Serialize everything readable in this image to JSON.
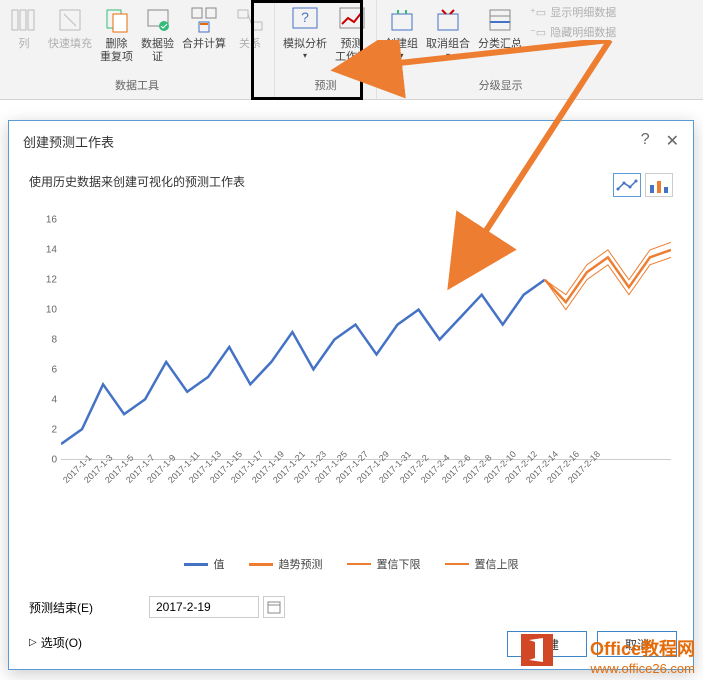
{
  "ribbon": {
    "groups": [
      {
        "label": "数据工具",
        "buttons": [
          {
            "name": "columns-btn",
            "label": "列",
            "disabled": true
          },
          {
            "name": "flash-fill-btn",
            "label": "快速填充",
            "disabled": true
          },
          {
            "name": "remove-dup-btn",
            "label": "删除\n重复项"
          },
          {
            "name": "data-validation-btn",
            "label": "数据验\n证"
          },
          {
            "name": "consolidate-btn",
            "label": "合并计算"
          },
          {
            "name": "relations-btn",
            "label": "关系",
            "disabled": true
          }
        ]
      },
      {
        "label": "预测",
        "buttons": [
          {
            "name": "what-if-btn",
            "label": "模拟分析"
          },
          {
            "name": "forecast-sheet-btn",
            "label": "预测\n工作表"
          }
        ]
      },
      {
        "label": "分级显示",
        "buttons": [
          {
            "name": "group-btn",
            "label": "创建组"
          },
          {
            "name": "ungroup-btn",
            "label": "取消组合"
          },
          {
            "name": "subtotal-btn",
            "label": "分类汇总"
          }
        ],
        "text_buttons": [
          {
            "name": "show-detail-btn",
            "label": "显示明细数据"
          },
          {
            "name": "hide-detail-btn",
            "label": "隐藏明细数据"
          }
        ]
      }
    ]
  },
  "dialog": {
    "title": "创建预测工作表",
    "subtitle": "使用历史数据来创建可视化的预测工作表",
    "help": "?",
    "close": "✕",
    "form": {
      "end_label": "预测结束(E)",
      "end_value": "2017-2-19"
    },
    "options_label": "选项(O)",
    "ok_label": "创建",
    "cancel_label": "取消"
  },
  "chart_data": {
    "type": "line",
    "ylim": [
      0,
      16
    ],
    "yticks": [
      0,
      2,
      4,
      6,
      8,
      10,
      12,
      14,
      16
    ],
    "categories": [
      "2017-1-1",
      "2017-1-3",
      "2017-1-5",
      "2017-1-7",
      "2017-1-9",
      "2017-1-11",
      "2017-1-13",
      "2017-1-15",
      "2017-1-17",
      "2017-1-19",
      "2017-1-21",
      "2017-1-23",
      "2017-1-25",
      "2017-1-27",
      "2017-1-29",
      "2017-1-31",
      "2017-2-2",
      "2017-2-4",
      "2017-2-6",
      "2017-2-8",
      "2017-2-10",
      "2017-2-12",
      "2017-2-14",
      "2017-2-16",
      "2017-2-18"
    ],
    "series": [
      {
        "name": "值",
        "color": "#4472c4",
        "values": [
          1,
          2,
          5,
          3,
          4,
          6.5,
          4.5,
          5.5,
          7.5,
          5,
          6.5,
          8.5,
          6,
          8,
          9,
          7,
          9,
          10,
          8,
          9.5,
          11,
          9,
          11,
          12,
          null
        ]
      },
      {
        "name": "趋势预测",
        "color": "#ed7d31",
        "values": [
          null,
          null,
          null,
          null,
          null,
          null,
          null,
          null,
          null,
          null,
          null,
          null,
          null,
          null,
          null,
          null,
          null,
          null,
          null,
          null,
          null,
          null,
          null,
          12,
          10.5,
          12.5,
          13.5,
          11.5,
          13.5,
          14
        ]
      },
      {
        "name": "置信下限",
        "color": "#ed7d31",
        "thin": true,
        "values": [
          null,
          null,
          null,
          null,
          null,
          null,
          null,
          null,
          null,
          null,
          null,
          null,
          null,
          null,
          null,
          null,
          null,
          null,
          null,
          null,
          null,
          null,
          null,
          12,
          10,
          12,
          13,
          11,
          13,
          13.5
        ]
      },
      {
        "name": "置信上限",
        "color": "#ed7d31",
        "thin": true,
        "values": [
          null,
          null,
          null,
          null,
          null,
          null,
          null,
          null,
          null,
          null,
          null,
          null,
          null,
          null,
          null,
          null,
          null,
          null,
          null,
          null,
          null,
          null,
          null,
          12,
          11,
          13,
          14,
          12,
          14,
          14.5
        ]
      }
    ],
    "legend": [
      {
        "label": "值",
        "color": "#4472c4",
        "thick": true
      },
      {
        "label": "趋势预测",
        "color": "#ed7d31",
        "thick": true
      },
      {
        "label": "置信下限",
        "color": "#ed7d31",
        "thick": false
      },
      {
        "label": "置信上限",
        "color": "#ed7d31",
        "thick": false
      }
    ]
  },
  "watermark": {
    "title": "Office教程网",
    "url": "www.office26.com"
  }
}
